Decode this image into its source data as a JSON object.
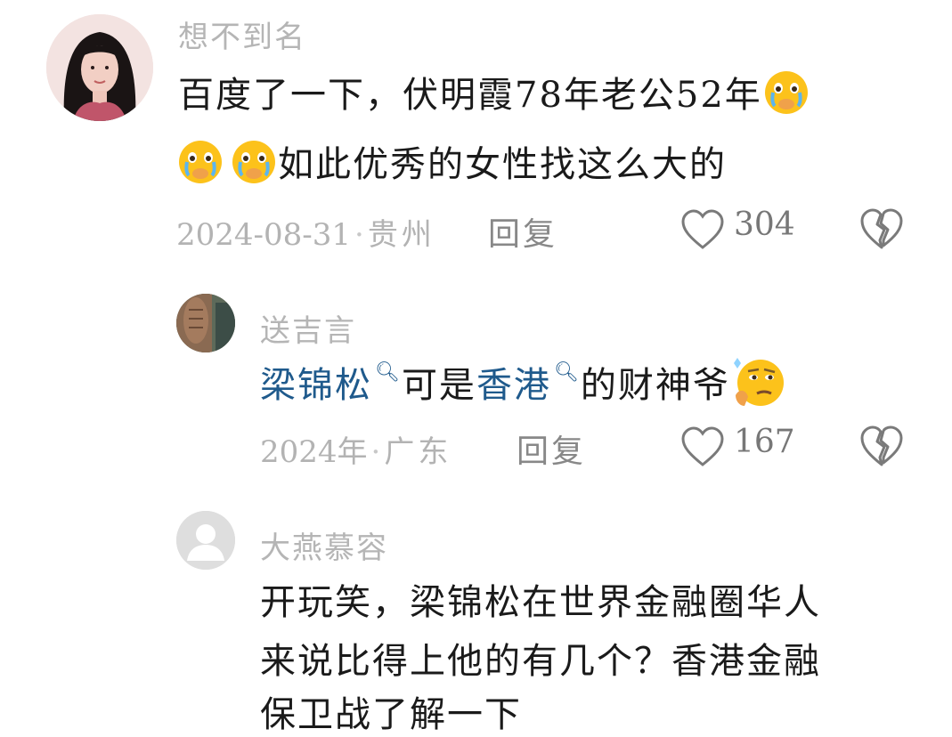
{
  "comments": [
    {
      "username": "想不到名",
      "text_line1": "百度了一下，伏明霞78年老公52年",
      "text_line2": "如此优秀的女性找这么大的",
      "date": "2024-08-31",
      "location": "贵州",
      "reply_label": "回复",
      "likes": "304",
      "emoji_line1": "crying-face-icon",
      "emoji_line2": [
        "crying-face-icon",
        "crying-face-icon"
      ]
    },
    {
      "username": "送吉言",
      "link1": "梁锦松",
      "text_mid": "可是",
      "link2": "香港",
      "text_end": "的财神爷",
      "emoji": "thinking-face-icon",
      "date": "2024年",
      "location": "广东",
      "reply_label": "回复",
      "likes": "167"
    },
    {
      "username": "大燕慕容",
      "text_line1": "开玩笑，梁锦松在世界金融圈华人",
      "text_line2": "来说比得上他的有几个？香港金融",
      "text_line3": "保卫战了解一下"
    }
  ],
  "separator": "·",
  "colors": {
    "link": "#1f5a8c",
    "meta": "#b3b3b3",
    "username": "#b5b5b5"
  }
}
